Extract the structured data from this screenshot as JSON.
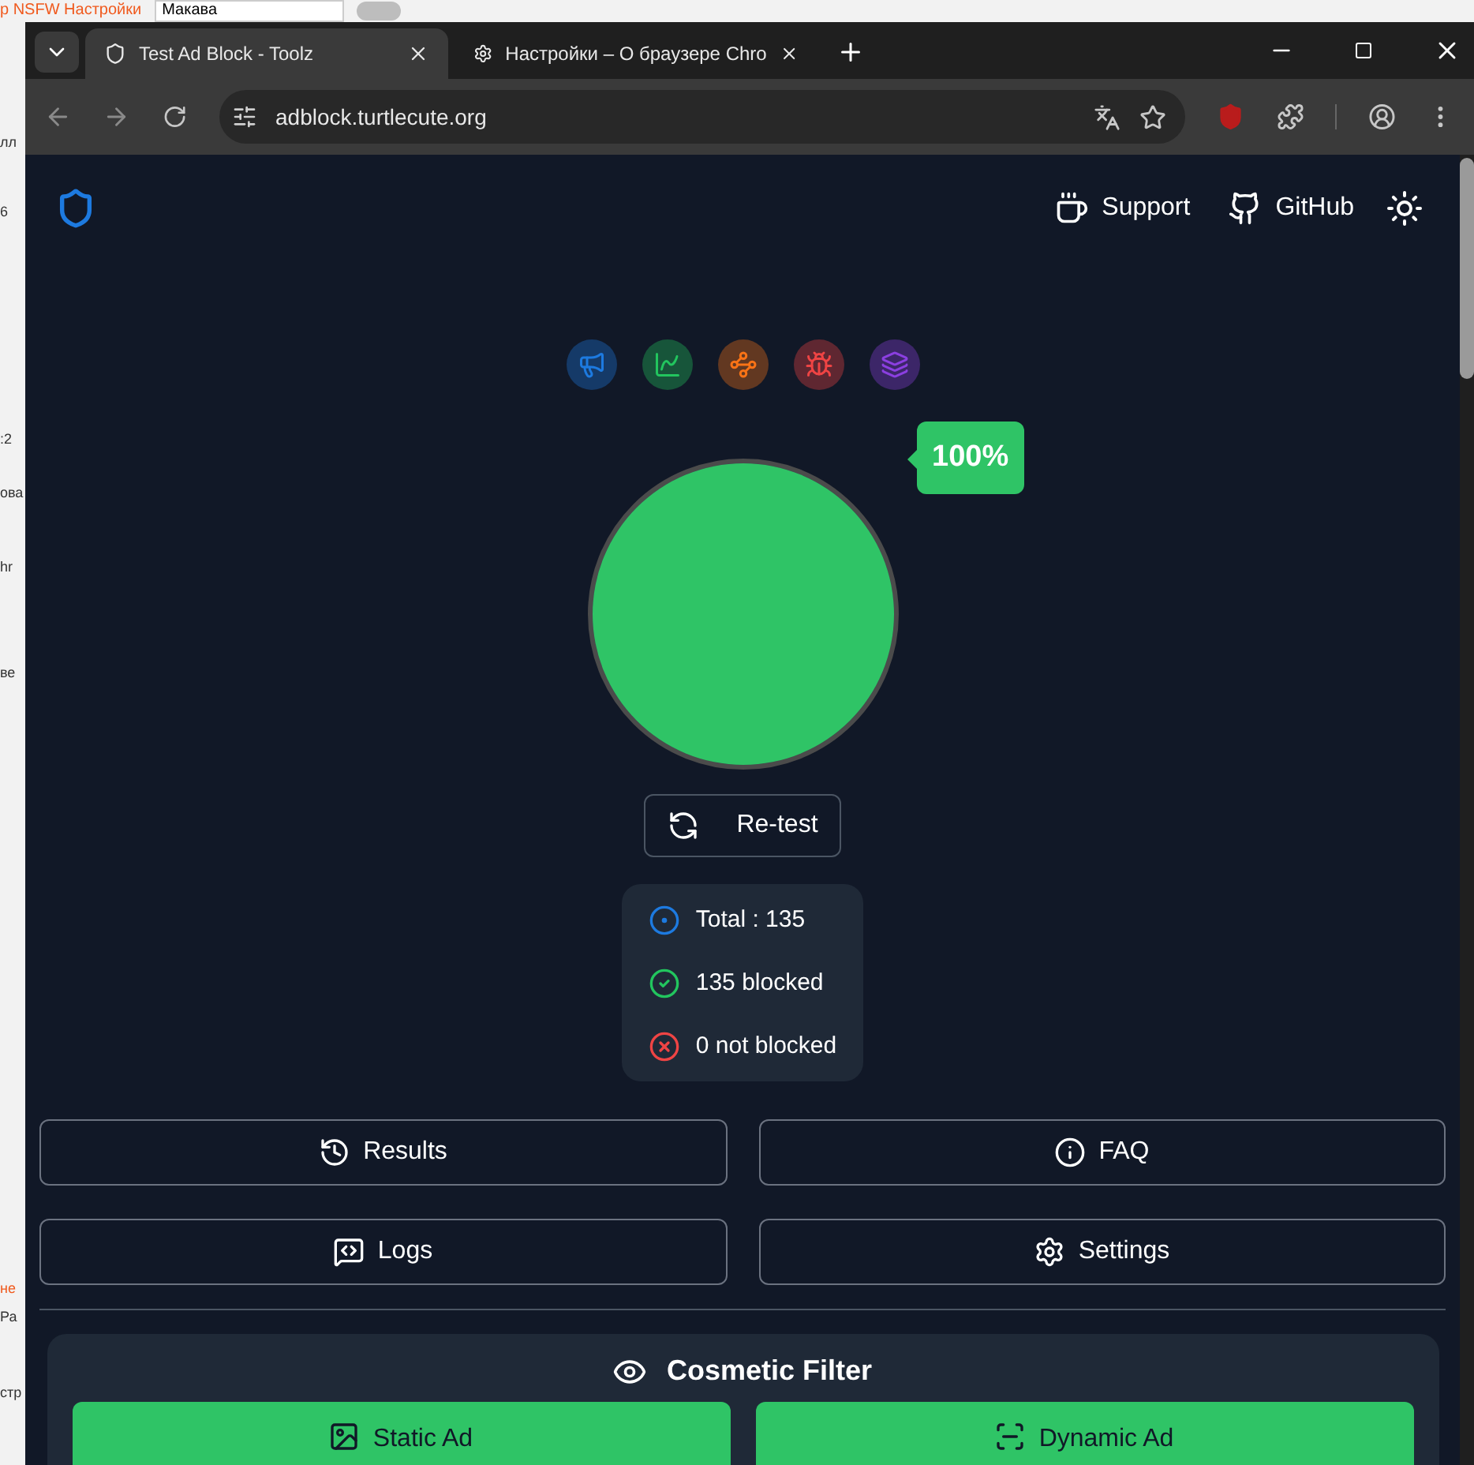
{
  "background_window": {
    "top_link": "р NSFW Настройки",
    "top_field": {
      "value": "Макава"
    },
    "toggle": {
      "on": false
    },
    "fragments": [
      "лл",
      "6",
      ":2",
      "ова",
      "hr",
      "ве",
      "не",
      "Ра",
      "стр"
    ]
  },
  "browser": {
    "tabs": [
      {
        "title": "Test Ad Block - Toolz",
        "selected": true
      },
      {
        "title": "Настройки – О браузере Chro",
        "selected": false
      }
    ],
    "address": "adblock.turtlecute.org"
  },
  "header": {
    "links": [
      "Support",
      "GitHub"
    ]
  },
  "categories": [
    {
      "color": "#1d7ae0"
    },
    {
      "color": "#22c55e"
    },
    {
      "color": "#f97316"
    },
    {
      "color": "#ef4444"
    },
    {
      "color": "#8b3fe0"
    }
  ],
  "score": {
    "level": 1,
    "reading": "100%"
  },
  "retest_button": "Re-test",
  "stats": [
    {
      "kind": "total",
      "text": "Total : 135"
    },
    {
      "kind": "blocked",
      "text": "135 blocked"
    },
    {
      "kind": "not_blocked",
      "text": "0 not blocked"
    }
  ],
  "actions": [
    {
      "kind": "results",
      "label": "Results"
    },
    {
      "kind": "faq",
      "label": "FAQ"
    },
    {
      "kind": "logs",
      "label": "Logs"
    },
    {
      "kind": "settings",
      "label": "Settings"
    }
  ],
  "cosmetic_filter": {
    "title": "Cosmetic Filter",
    "buttons": [
      {
        "kind": "static",
        "label": "Static Ad"
      },
      {
        "kind": "dynamic",
        "label": "Dynamic Ad"
      }
    ]
  }
}
